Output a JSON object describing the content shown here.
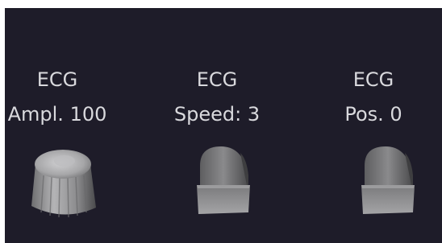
{
  "controls": [
    {
      "line1": "ECG",
      "line2": "Ampl. 100",
      "knob": "round-knob"
    },
    {
      "line1": "ECG",
      "line2": "Speed: 3",
      "knob": "switch-knob"
    },
    {
      "line1": "ECG",
      "line2": "Pos. 0",
      "knob": "switch-knob"
    }
  ]
}
